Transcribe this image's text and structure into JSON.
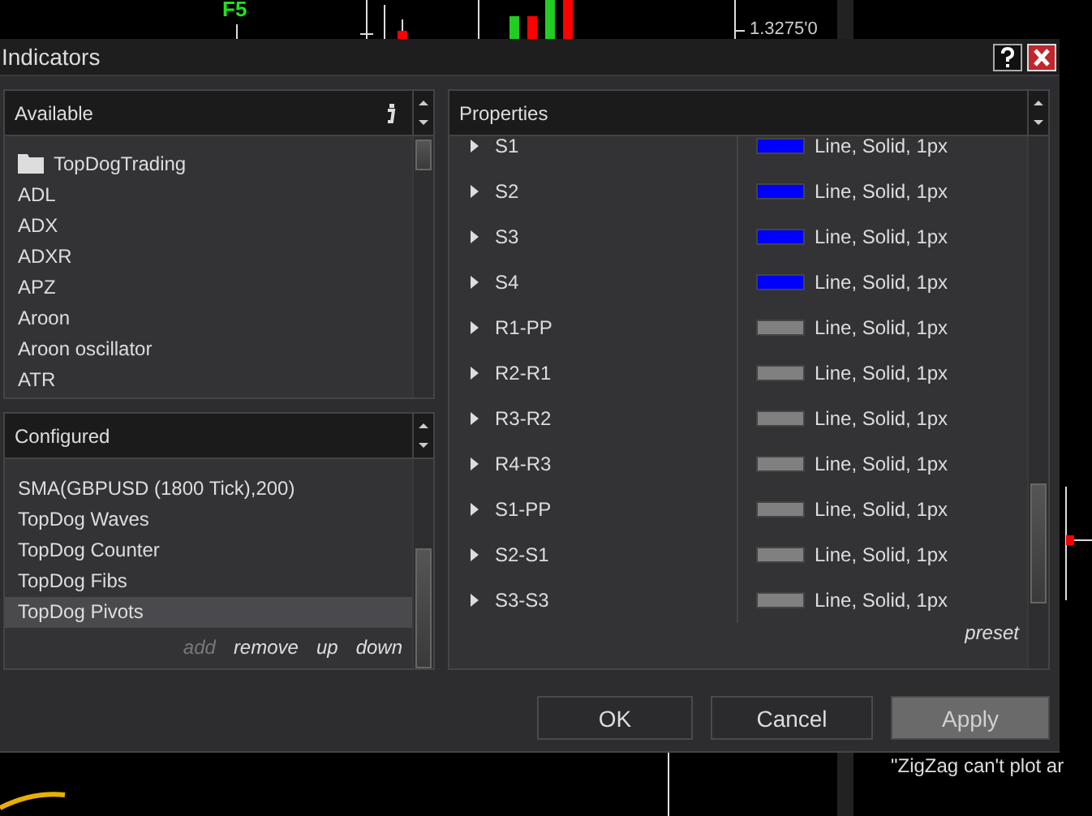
{
  "background": {
    "marker_label": "F5",
    "price_label": "1.3275'0",
    "message": "\"ZigZag can't plot ar"
  },
  "window": {
    "title": "Indicators"
  },
  "available": {
    "title": "Available",
    "items": [
      {
        "label": "TopDogTrading",
        "kind": "folder"
      },
      {
        "label": "ADL",
        "kind": "item"
      },
      {
        "label": "ADX",
        "kind": "item"
      },
      {
        "label": "ADXR",
        "kind": "item"
      },
      {
        "label": "APZ",
        "kind": "item"
      },
      {
        "label": "Aroon",
        "kind": "item"
      },
      {
        "label": "Aroon oscillator",
        "kind": "item"
      },
      {
        "label": "ATR",
        "kind": "item"
      }
    ]
  },
  "configured": {
    "title": "Configured",
    "items": [
      {
        "label": "SMA(GBPUSD (1800 Tick),200)",
        "selected": false
      },
      {
        "label": "TopDog Waves",
        "selected": false
      },
      {
        "label": "TopDog Counter",
        "selected": false
      },
      {
        "label": "TopDog Fibs",
        "selected": false
      },
      {
        "label": "TopDog Pivots",
        "selected": true
      }
    ],
    "actions": [
      {
        "label": "add",
        "disabled": true
      },
      {
        "label": "remove",
        "disabled": false
      },
      {
        "label": "up",
        "disabled": false
      },
      {
        "label": "down",
        "disabled": false
      }
    ]
  },
  "properties": {
    "title": "Properties",
    "rows": [
      {
        "name": "S1",
        "expanded": false,
        "color": "#0000ff",
        "value": "Line, Solid, 1px"
      },
      {
        "name": "S2",
        "expanded": false,
        "color": "#0000ff",
        "value": "Line, Solid, 1px"
      },
      {
        "name": "S3",
        "expanded": false,
        "color": "#0000ff",
        "value": "Line, Solid, 1px"
      },
      {
        "name": "S4",
        "expanded": false,
        "color": "#0000ff",
        "value": "Line, Solid, 1px"
      },
      {
        "name": "R1-PP",
        "expanded": false,
        "color": "#808080",
        "value": "Line, Solid, 1px"
      },
      {
        "name": "R2-R1",
        "expanded": false,
        "color": "#808080",
        "value": "Line, Solid, 1px"
      },
      {
        "name": "R3-R2",
        "expanded": false,
        "color": "#808080",
        "value": "Line, Solid, 1px"
      },
      {
        "name": "R4-R3",
        "expanded": false,
        "color": "#808080",
        "value": "Line, Solid, 1px"
      },
      {
        "name": "S1-PP",
        "expanded": false,
        "color": "#808080",
        "value": "Line, Solid, 1px"
      },
      {
        "name": "S2-S1",
        "expanded": false,
        "color": "#808080",
        "value": "Line, Solid, 1px"
      },
      {
        "name": "S3-S3",
        "expanded": false,
        "color": "#808080",
        "value": "Line, Solid, 1px"
      }
    ],
    "preset_link": "preset"
  },
  "buttons": [
    {
      "label": "OK",
      "disabled": false
    },
    {
      "label": "Cancel",
      "disabled": false
    },
    {
      "label": "Apply",
      "disabled": true
    }
  ]
}
